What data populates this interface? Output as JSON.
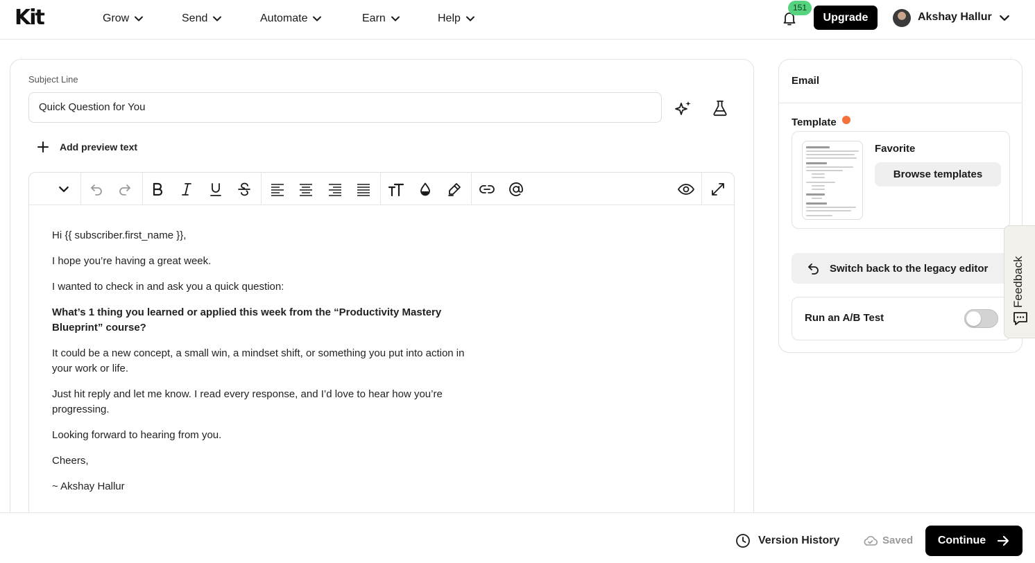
{
  "nav": {
    "logo": "Kit",
    "items": [
      {
        "label": "Grow"
      },
      {
        "label": "Send"
      },
      {
        "label": "Automate"
      },
      {
        "label": "Earn"
      },
      {
        "label": "Help"
      }
    ],
    "notification_count": "151",
    "upgrade_label": "Upgrade",
    "user_name": "Akshay Hallur"
  },
  "editor": {
    "subject_label": "Subject Line",
    "subject_value": "Quick Question for You",
    "add_preview_label": "Add preview text",
    "body": [
      {
        "text": "Hi {{ subscriber.first_name }},",
        "bold": false
      },
      {
        "text": "I hope you’re having a great week.",
        "bold": false
      },
      {
        "text": "I wanted to check in and ask you a quick question:",
        "bold": false
      },
      {
        "text": "What’s 1 thing you learned or applied this week from the “Productivity Mastery Blueprint” course?",
        "bold": true
      },
      {
        "text": "It could be a new concept, a small win, a mindset shift, or something you put into action in your work or life.",
        "bold": false
      },
      {
        "text": "Just hit reply and let me know. I read every response, and I’d love to hear how you’re progressing.",
        "bold": false
      },
      {
        "text": "Looking forward to hearing from you.",
        "bold": false
      },
      {
        "text": "Cheers,",
        "bold": false
      },
      {
        "text": "~ Akshay Hallur",
        "bold": false
      }
    ]
  },
  "sidebar": {
    "heading": "Email",
    "template_label": "Template",
    "template_name": "Favorite",
    "browse_label": "Browse templates",
    "legacy_label": "Switch back to the legacy editor",
    "ab_label": "Run an A/B Test",
    "ab_enabled": false
  },
  "feedback_label": "Feedback",
  "footer": {
    "version_history_label": "Version History",
    "saved_label": "Saved",
    "continue_label": "Continue"
  },
  "colors": {
    "primary": "#000000",
    "badge": "#56d37f",
    "template_dot": "#f5713c"
  }
}
